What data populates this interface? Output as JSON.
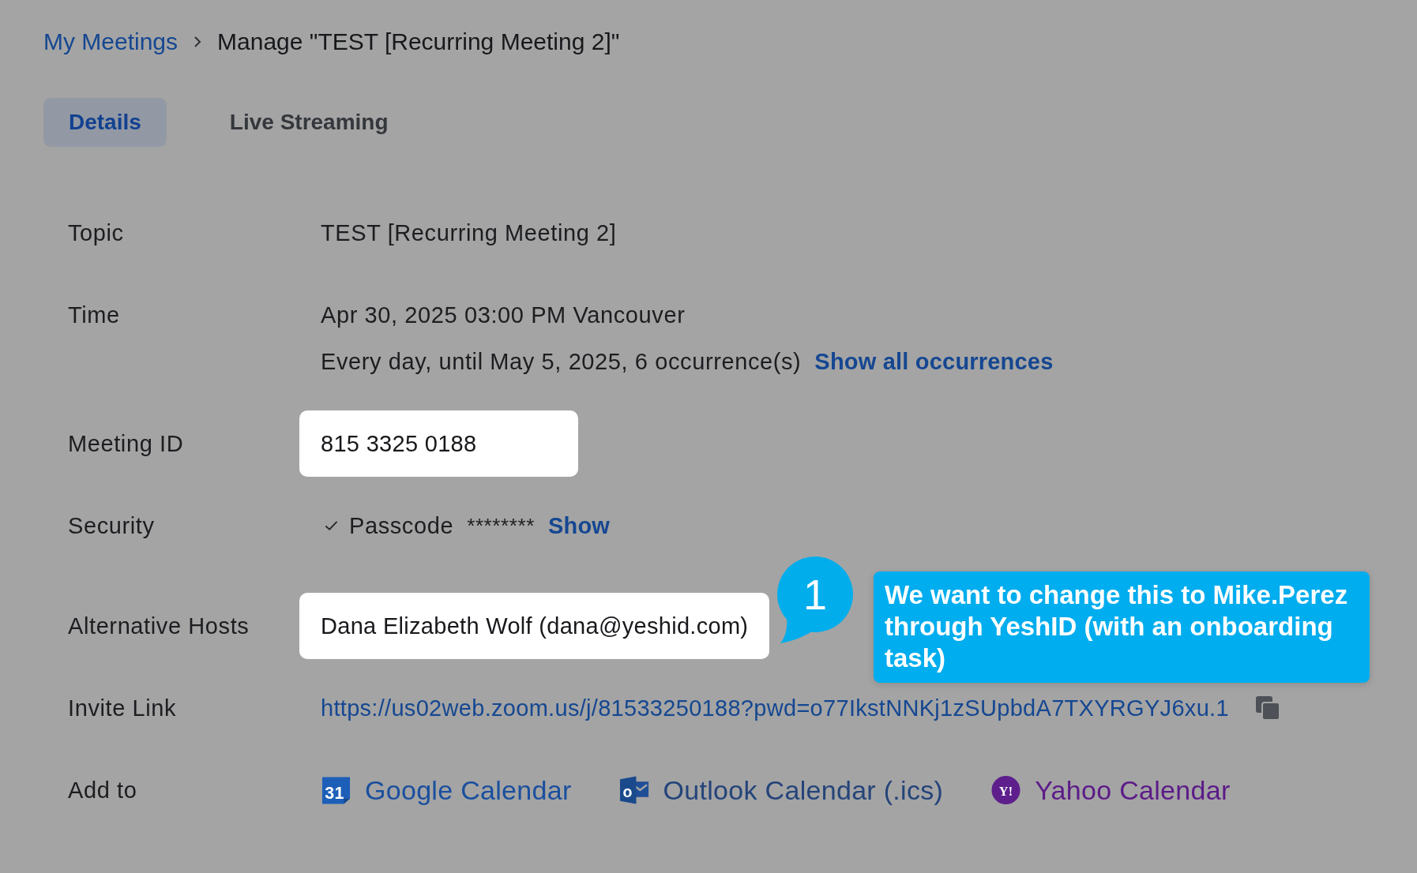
{
  "breadcrumb": [
    {
      "label": "My Meetings",
      "kind": "link"
    },
    {
      "label": "Manage \"TEST [Recurring Meeting 2]\"",
      "kind": "current"
    }
  ],
  "tabs": [
    {
      "label": "Details",
      "selected": true
    },
    {
      "label": "Live Streaming",
      "selected": false
    }
  ],
  "fields": [
    {
      "label": "Topic",
      "kind": "text",
      "value": "TEST [Recurring Meeting 2]",
      "highlighted": false
    },
    {
      "label": "Time",
      "kind": "time",
      "value": "Apr 30, 2025 03:00 PM Vancouver",
      "recurrence": "Every day, until May 5, 2025, 6 occurrence(s)",
      "link": "Show all occurrences"
    },
    {
      "label": "Meeting ID",
      "kind": "text",
      "value": "815 3325 0188",
      "highlighted": true
    },
    {
      "label": "Security",
      "kind": "passcode",
      "checked": true,
      "name": "Passcode",
      "value": "********",
      "link": "Show"
    },
    {
      "label": "Alternative Hosts",
      "kind": "text",
      "value": "Dana Elizabeth Wolf (dana@yeshid.com)",
      "highlighted": true
    },
    {
      "label": "Invite Link",
      "kind": "link",
      "value": "https://us02web.zoom.us/j/81533250188?pwd=o77IkstNNKj1zSUpbdA7TXYRGYJ6xu.1"
    },
    {
      "label": "Add to",
      "kind": "calendars",
      "calendars": [
        {
          "label": "Google Calendar",
          "kind": "google",
          "icon_text": "31"
        },
        {
          "label": "Outlook Calendar (.ics)",
          "kind": "outlook",
          "icon_text": "o"
        },
        {
          "label": "Yahoo Calendar",
          "kind": "yahoo",
          "icon_text": "Y!"
        }
      ]
    }
  ],
  "annotation": {
    "number": "1",
    "text": "We want to change this to Mike.Perez through YeshID (with an onboarding task)"
  }
}
